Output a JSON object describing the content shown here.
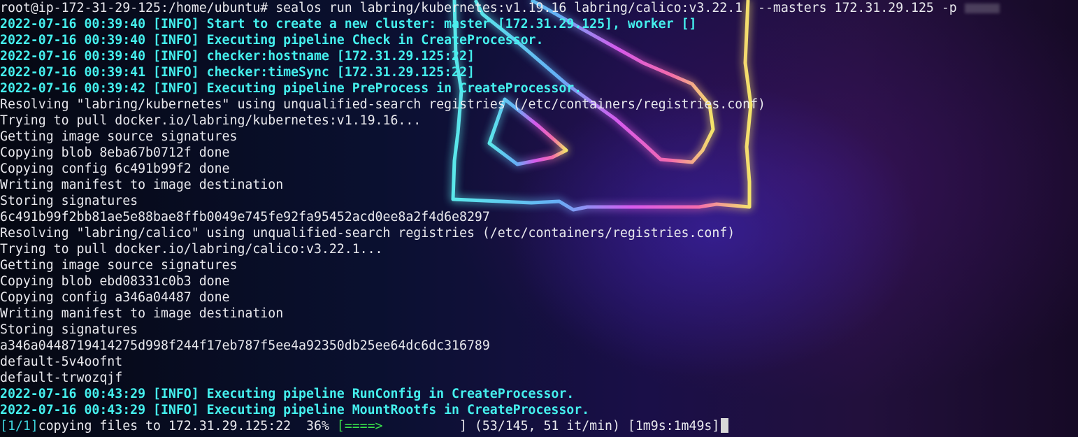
{
  "terminal": {
    "command_line": "root@ip-172-31-29-125:/home/ubuntu# sealos run labring/kubernetes:v1.19.16 labring/calico:v3.22.1  --masters 172.31.29.125 -p",
    "lines": [
      {
        "text": "2022-07-16 00:39:40 [INFO] Start to create a new cluster: master [172.31.29.125], worker []",
        "type": "info"
      },
      {
        "text": "2022-07-16 00:39:40 [INFO] Executing pipeline Check in CreateProcessor.",
        "type": "info"
      },
      {
        "text": "2022-07-16 00:39:40 [INFO] checker:hostname [172.31.29.125:22]",
        "type": "info"
      },
      {
        "text": "2022-07-16 00:39:41 [INFO] checker:timeSync [172.31.29.125:22]",
        "type": "info"
      },
      {
        "text": "2022-07-16 00:39:42 [INFO] Executing pipeline PreProcess in CreateProcessor.",
        "type": "info"
      },
      {
        "text": "Resolving \"labring/kubernetes\" using unqualified-search registries (/etc/containers/registries.conf)",
        "type": "plain"
      },
      {
        "text": "Trying to pull docker.io/labring/kubernetes:v1.19.16...",
        "type": "plain"
      },
      {
        "text": "Getting image source signatures",
        "type": "plain"
      },
      {
        "text": "Copying blob 8eba67b0712f done",
        "type": "plain"
      },
      {
        "text": "Copying config 6c491b99f2 done",
        "type": "plain"
      },
      {
        "text": "Writing manifest to image destination",
        "type": "plain"
      },
      {
        "text": "Storing signatures",
        "type": "plain"
      },
      {
        "text": "6c491b99f2bb81ae5e88bae8ffb0049e745fe92fa95452acd0ee8a2f4d6e8297",
        "type": "plain"
      },
      {
        "text": "Resolving \"labring/calico\" using unqualified-search registries (/etc/containers/registries.conf)",
        "type": "plain"
      },
      {
        "text": "Trying to pull docker.io/labring/calico:v3.22.1...",
        "type": "plain"
      },
      {
        "text": "Getting image source signatures",
        "type": "plain"
      },
      {
        "text": "Copying blob ebd08331c0b3 done",
        "type": "plain"
      },
      {
        "text": "Copying config a346a04487 done",
        "type": "plain"
      },
      {
        "text": "Writing manifest to image destination",
        "type": "plain"
      },
      {
        "text": "Storing signatures",
        "type": "plain"
      },
      {
        "text": "a346a0448719414275d998f244f17eb787f5ee4a92350db25ee64dc6dc316789",
        "type": "plain"
      },
      {
        "text": "default-5v4oofnt",
        "type": "plain"
      },
      {
        "text": "default-trwozqjf",
        "type": "plain"
      },
      {
        "text": "2022-07-16 00:43:29 [INFO] Executing pipeline RunConfig in CreateProcessor.",
        "type": "info"
      },
      {
        "text": "2022-07-16 00:43:29 [INFO] Executing pipeline MountRootfs in CreateProcessor.",
        "type": "info"
      }
    ],
    "progress": {
      "step": "[1/1]",
      "label": "copying files to 172.31.29.125:22  36% ",
      "bar_open": "[",
      "bar_fill": "====>",
      "bar_rest": "          ] (53/145, 51 it/min) [1m9s:1m49s]",
      "percent": 36
    }
  },
  "colors": {
    "info_text": "#45f0ee",
    "plain_text": "#e9e9ee",
    "progress_bar": "#38e04a",
    "progress_step": "#3fd7e0"
  },
  "background": {
    "wallpaper_logo": "dota-2-neon-logo"
  }
}
